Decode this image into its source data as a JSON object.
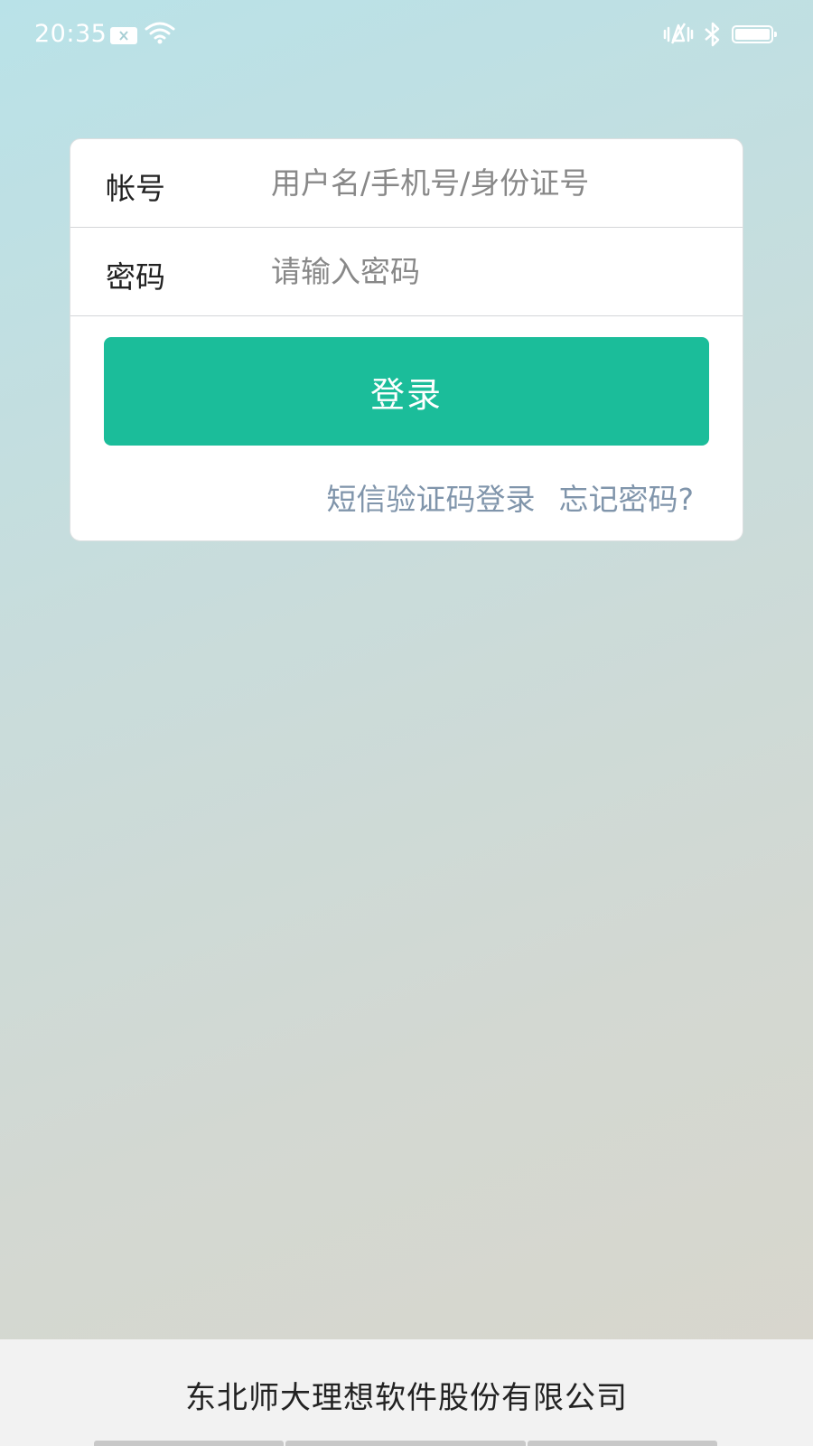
{
  "status_bar": {
    "time": "20:35",
    "icons": [
      "sim-error-icon",
      "wifi-icon",
      "vibrate-icon",
      "bluetooth-icon",
      "battery-icon"
    ],
    "battery_level": 1.0
  },
  "login": {
    "account_label": "帐号",
    "account_placeholder": "用户名/手机号/身份证号",
    "account_value": "",
    "password_label": "密码",
    "password_placeholder": "请输入密码",
    "password_value": "",
    "login_button": "登录",
    "sms_login_link": "短信验证码登录",
    "forgot_password_link": "忘记密码?"
  },
  "footer": {
    "company": "东北师大理想软件股份有限公司"
  },
  "colors": {
    "accent": "#1bbd9a",
    "link": "#8095ab",
    "card": "#ffffff",
    "footer_bg": "#f2f2f2"
  }
}
